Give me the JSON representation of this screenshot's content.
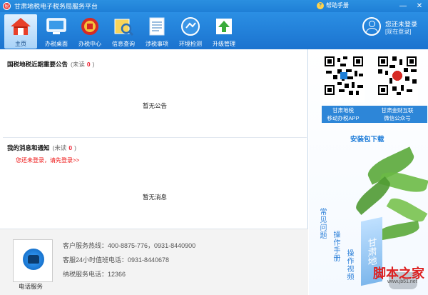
{
  "window": {
    "logo_char": "税",
    "title": "甘肃地税电子税务局服务平台",
    "help_label": "帮助手册",
    "min_glyph": "—",
    "close_glyph": "✕"
  },
  "toolbar": {
    "items": [
      {
        "label": "主页",
        "icon": "home-icon"
      },
      {
        "label": "办税桌面",
        "icon": "desktop-icon"
      },
      {
        "label": "办税中心",
        "icon": "tax-emblem-icon"
      },
      {
        "label": "信息查询",
        "icon": "query-icon"
      },
      {
        "label": "涉税事项",
        "icon": "document-icon"
      },
      {
        "label": "环境检测",
        "icon": "detect-icon"
      },
      {
        "label": "升级管理",
        "icon": "upgrade-icon"
      }
    ]
  },
  "user": {
    "status": "您还未登录",
    "login": "[现在登录]"
  },
  "announcement": {
    "title": "国税地税近期重要公告",
    "unread_prefix": "(未读",
    "count": "0",
    "unread_suffix": ")",
    "empty": "暂无公告"
  },
  "messages": {
    "title": "我的消息和通知",
    "unread_prefix": "(未读",
    "count": "0",
    "unread_suffix": ")",
    "login_hint": "您还未登录，请先登录>>",
    "empty": "暂无消息"
  },
  "contact": {
    "label": "电话服务",
    "lines": [
      "客户服务热线：400-8875-776，0931-8440900",
      "客服24小时值班电话：0931-8440678",
      "纳税服务电话：12366"
    ]
  },
  "side": {
    "qr1_label_1": "甘肃地税",
    "qr1_label_2": "移动办税APP",
    "qr2_label_1": "甘肃金财互联",
    "qr2_label_2": "微信公众号",
    "install": "安装包下载",
    "faq": "常见问题",
    "manual": "操作手册",
    "video": "操作视频",
    "gansu_text": "甘肃地",
    "watermark": "脚本之家",
    "watermark_url": "www.jb51.net"
  },
  "colors": {
    "accent": "#1f7fd6",
    "alert": "#e22222"
  }
}
